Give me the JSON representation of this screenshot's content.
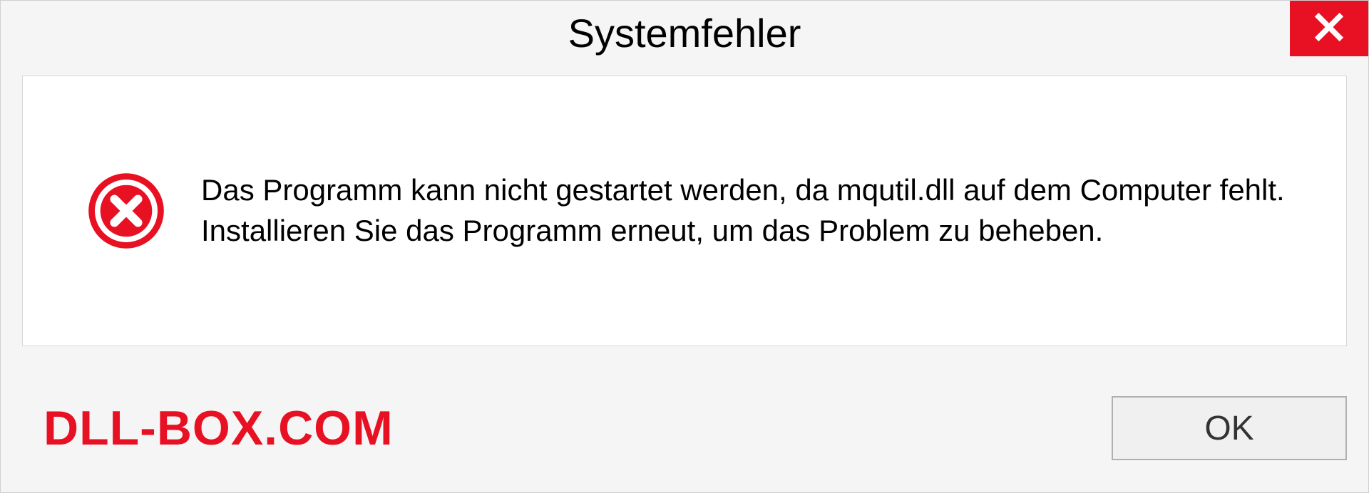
{
  "dialog": {
    "title": "Systemfehler",
    "message": "Das Programm kann nicht gestartet werden, da mqutil.dll auf dem Computer fehlt. Installieren Sie das Programm erneut, um das Problem zu beheben.",
    "ok_label": "OK"
  },
  "watermark": "DLL-BOX.COM"
}
